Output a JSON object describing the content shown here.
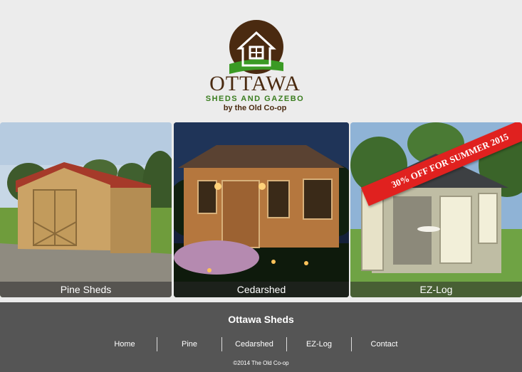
{
  "logo": {
    "title": "OTTAWA",
    "subtitle": "SHEDS AND GAZEBO",
    "byline": "by the Old Co-op",
    "colors": {
      "brown": "#4a2a10",
      "green": "#3a7d1f"
    }
  },
  "gallery": {
    "panels": [
      {
        "caption": "Pine Sheds"
      },
      {
        "caption": "Cedarshed"
      },
      {
        "caption": "EZ-Log",
        "promo": "30% OFF FOR SUMMER 2015"
      }
    ]
  },
  "footer": {
    "title": "Ottawa Sheds",
    "nav": [
      "Home",
      "Pine",
      "Cedarshed",
      "EZ-Log",
      "Contact"
    ],
    "copyright": "©2014 The Old Co-op"
  }
}
